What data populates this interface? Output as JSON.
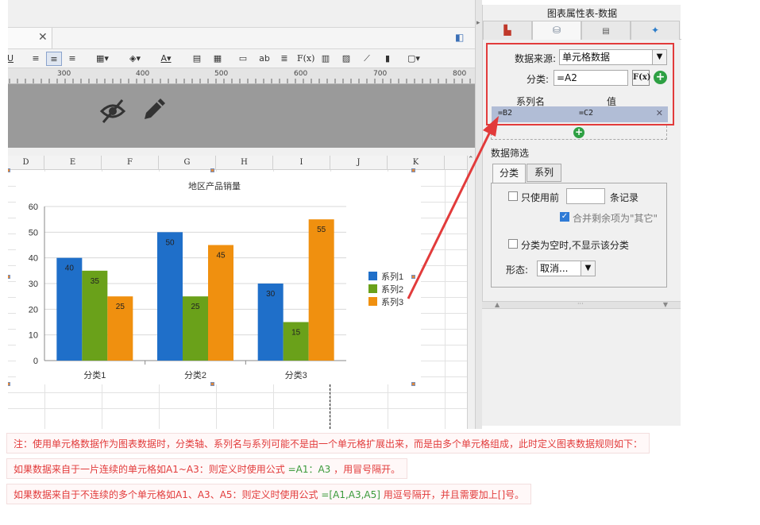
{
  "panel": {
    "title": "图表属性表-数据",
    "data_source_label": "数据来源:",
    "data_source_value": "单元格数据",
    "category_label": "分类:",
    "category_value": "=A2",
    "fx_label": "F(x)",
    "series_name_header": "系列名",
    "value_header": "值",
    "series_name_value": "=B2",
    "series_value": "=C2",
    "filter_title": "数据筛选",
    "filter_tabs": [
      "分类",
      "系列"
    ],
    "use_first_label": "只使用前",
    "records_label": "条记录",
    "merge_label": "合并剩余项为\"其它\"",
    "hide_empty_label": "分类为空时,不显示该分类",
    "form_label": "形态:",
    "form_value": "取消..."
  },
  "sheet": {
    "columns": [
      "D",
      "E",
      "F",
      "G",
      "H",
      "I",
      "J",
      "K"
    ],
    "ruler_labels": [
      "300",
      "400",
      "500",
      "600",
      "700",
      "800"
    ]
  },
  "chart_data": {
    "type": "bar",
    "title": "地区产品销量",
    "categories": [
      "分类1",
      "分类2",
      "分类3"
    ],
    "series": [
      {
        "name": "系列1",
        "values": [
          40,
          50,
          30
        ],
        "color": "#1f6fc9"
      },
      {
        "name": "系列2",
        "values": [
          35,
          25,
          15
        ],
        "color": "#6aa11a"
      },
      {
        "name": "系列3",
        "values": [
          25,
          45,
          55
        ],
        "color": "#f0900f"
      }
    ],
    "ylim": [
      0,
      60
    ],
    "yticks": [
      0,
      10,
      20,
      30,
      40,
      50,
      60
    ],
    "grid": true,
    "legend": "right"
  },
  "notes": {
    "line1": "注：使用单元格数据作为图表数据时，分类轴、系列名与系列可能不是由一个单元格扩展出来，而是由多个单元格组成，此时定义图表数据规则如下：",
    "line2_a": "如果数据来自于一片连续的单元格如A1~A3：则定义时使用公式",
    "line2_f": "=A1：A3",
    "line2_b": "，用冒号隔开。",
    "line3_a": "如果数据来自于不连续的多个单元格如A1、A3、A5：则定义时使用公式",
    "line3_f": "=[A1,A3,A5]",
    "line3_b": "用逗号隔开，并且需要加上[]号。"
  }
}
